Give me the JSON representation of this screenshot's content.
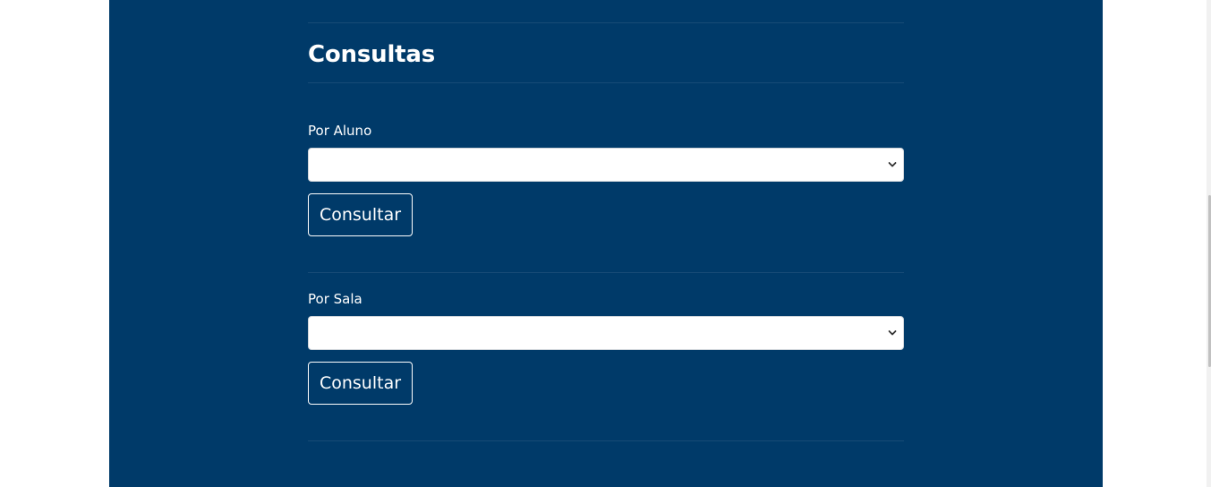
{
  "section": {
    "title": "Consultas"
  },
  "queries": [
    {
      "label": "Por Aluno",
      "selected_value": "",
      "button_label": "Consultar"
    },
    {
      "label": "Por Sala",
      "selected_value": "",
      "button_label": "Consultar"
    }
  ],
  "colors": {
    "panel_background": "#003a69",
    "page_background": "#ffffff",
    "text": "#ffffff"
  },
  "icons": {
    "select_arrow": "chevron-down-icon"
  }
}
